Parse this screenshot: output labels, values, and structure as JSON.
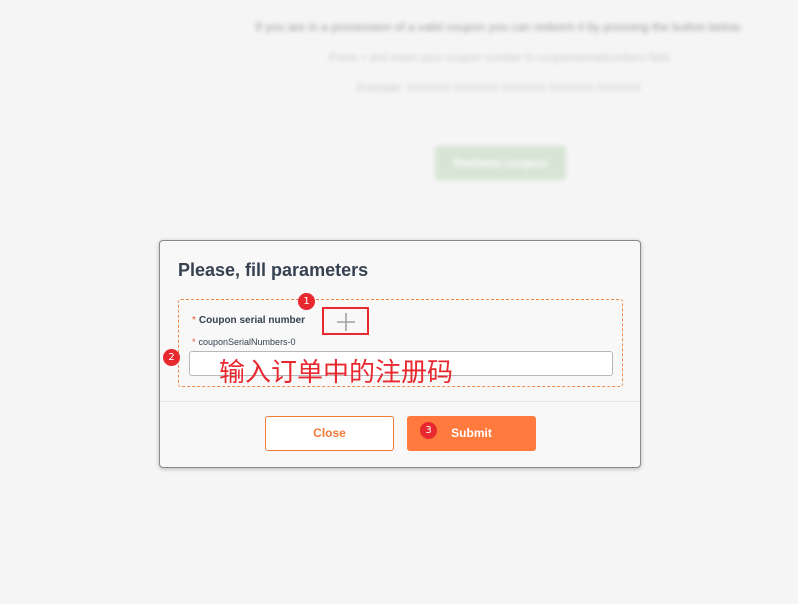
{
  "background": {
    "line1": "If you are in a possession of a valid coupon you can redeem it by pressing the button below.",
    "line2": "Press + and insert your coupon number to couponSerialNumbers field",
    "line3": "Example: XXXXXX-XXXXXX-XXXXXX-XXXXXX-XXXXXX",
    "button_label": "Redeem coupon"
  },
  "dialog": {
    "title": "Please, fill parameters",
    "field_label": "Coupon serial number",
    "required_mark": "*",
    "sub_field_label": "couponSerialNumbers-0",
    "input_value": "",
    "annotation_text": "输入订单中的注册码",
    "close_label": "Close",
    "submit_label": "Submit"
  },
  "annotations": {
    "badge1": "1",
    "badge2": "2",
    "badge3": "3"
  },
  "colors": {
    "accent": "#ff7a3c",
    "annotation_red": "#e8282f",
    "required_red": "#e8522b"
  }
}
